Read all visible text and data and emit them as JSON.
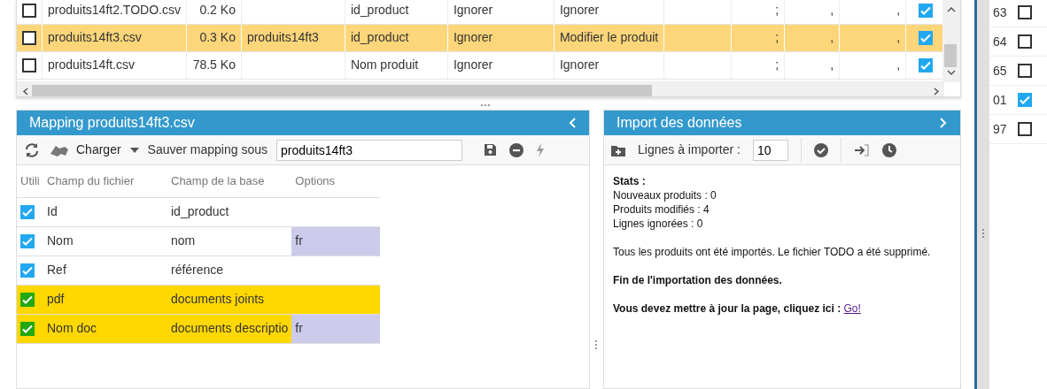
{
  "files": {
    "rows": [
      {
        "checked": false,
        "selected": false,
        "enabled": true,
        "cells": {
          "file": "produits14ft2.TODO.csv",
          "size": "0.2 Ko",
          "column_4": "id_product",
          "column_5": "Ignorer",
          "column_6": "Ignorer",
          "column_8": ";",
          "column_9": ",",
          "column_10": ","
        }
      },
      {
        "checked": false,
        "selected": true,
        "enabled": true,
        "cells": {
          "file": "produits14ft3.csv",
          "size": "0.3 Ko",
          "column_3": "produits14ft3",
          "column_4": "id_product",
          "column_5": "Ignorer",
          "column_6": "Modifier le produit",
          "column_8": ";",
          "column_9": ",",
          "column_10": ","
        }
      },
      {
        "checked": false,
        "selected": false,
        "enabled": true,
        "cells": {
          "file": "produits14ft.csv",
          "size": "78.5 Ko",
          "column_4": "Nom produit",
          "column_5": "Ignorer",
          "column_6": "Ignorer",
          "column_8": ";",
          "column_9": ",",
          "column_10": ","
        }
      }
    ]
  },
  "side_list": [
    {
      "label": "63",
      "checked": false
    },
    {
      "label": "64",
      "checked": false
    },
    {
      "label": "65",
      "checked": false
    },
    {
      "label": "01",
      "checked": true
    },
    {
      "label": "97",
      "checked": false
    }
  ],
  "mapping": {
    "title": "Mapping produits14ft3.csv",
    "load_label": "Charger",
    "save_label": "Sauver mapping sous",
    "save_name": "produits14ft3",
    "columns": [
      "Utili",
      "Champ du fichier",
      "Champ de la base",
      "Options"
    ],
    "rows": [
      {
        "used": true,
        "highlighted": false,
        "file_field": "Id",
        "db_field": "id_product"
      },
      {
        "used": true,
        "highlighted": false,
        "file_field": "Nom",
        "db_field": "nom",
        "option": "fr"
      },
      {
        "used": true,
        "highlighted": false,
        "file_field": "Ref",
        "db_field": "référence"
      },
      {
        "used": true,
        "highlighted": true,
        "file_field": "pdf",
        "db_field": "documents joints"
      },
      {
        "used": true,
        "highlighted": true,
        "file_field": "Nom doc",
        "db_field": "documents descriptio",
        "option": "fr"
      }
    ]
  },
  "import": {
    "title": "Import des données",
    "lines_label": "Lignes à importer :",
    "lines_value": "10",
    "stats_title": "Stats :",
    "stats": [
      "Nouveaux produits : 0",
      "Produits modifiés : 4",
      "Lignes ignorées : 0"
    ],
    "message": "Tous les produits ont été importés. Le fichier TODO a été supprimé.",
    "end_text": "Fin de l'importation des données.",
    "update_text": "Vous devez mettre à jour la page, cliquez ici :",
    "update_link": "Go!"
  }
}
